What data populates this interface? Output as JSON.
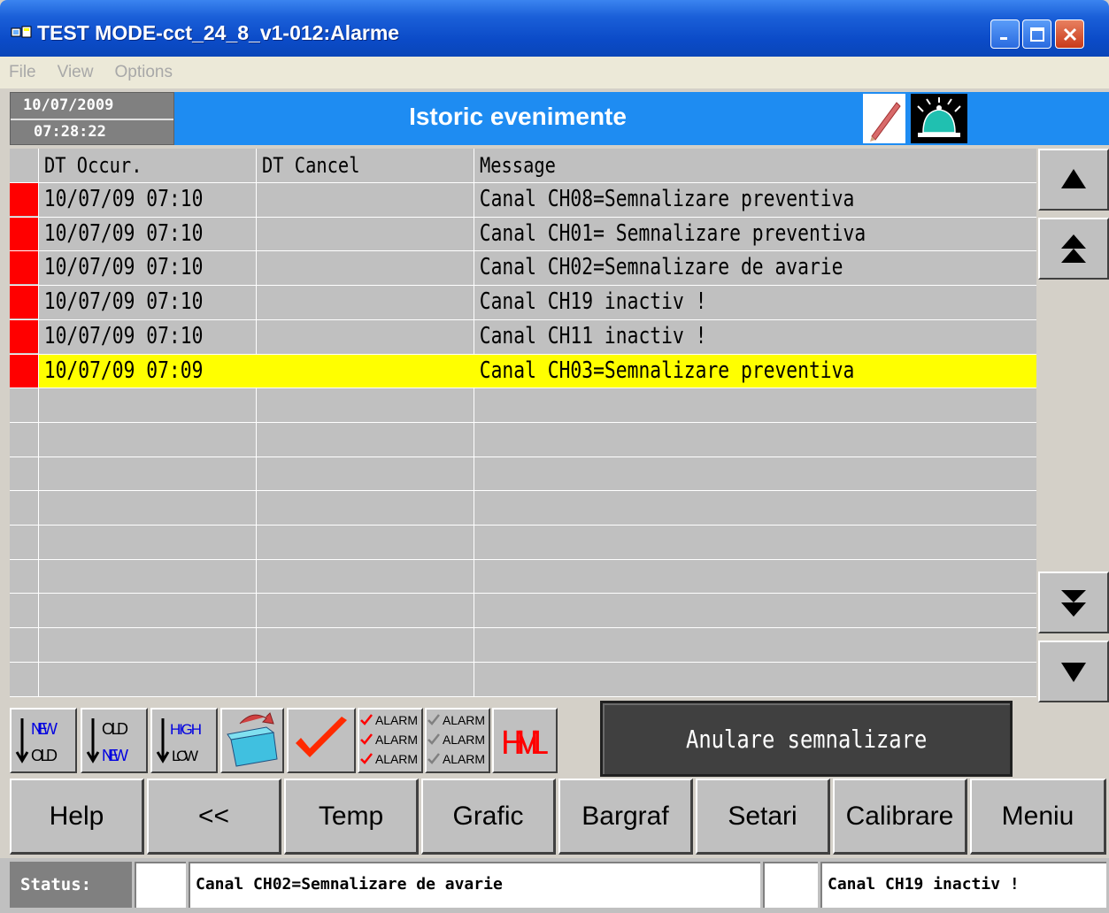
{
  "window": {
    "title": "TEST MODE-cct_24_8_v1-012:Alarme",
    "controls": {
      "minimize": "_",
      "maximize": "□",
      "close": "✕"
    }
  },
  "menu": [
    "File",
    "View",
    "Options"
  ],
  "header": {
    "date": "10/07/2009",
    "time": "07:28:22",
    "title": "Istoric evenimente",
    "icons": [
      "pencil-icon",
      "alarm-bell-icon"
    ]
  },
  "table": {
    "columns": [
      "DT Occur.",
      "DT Cancel",
      "Message"
    ],
    "rows": [
      {
        "occur": "10/07/09 07:10",
        "cancel": "",
        "message": "Canal CH08=Semnalizare preventiva",
        "highlight": false
      },
      {
        "occur": "10/07/09 07:10",
        "cancel": "",
        "message": "Canal CH01= Semnalizare preventiva",
        "highlight": false
      },
      {
        "occur": "10/07/09 07:10",
        "cancel": "",
        "message": "Canal CH02=Semnalizare de avarie",
        "highlight": false
      },
      {
        "occur": "10/07/09 07:10",
        "cancel": "",
        "message": "Canal CH19 inactiv !",
        "highlight": false
      },
      {
        "occur": "10/07/09 07:10",
        "cancel": "",
        "message": "Canal CH11 inactiv !",
        "highlight": false
      },
      {
        "occur": "10/07/09 07:09",
        "cancel": "",
        "message": "Canal CH03=Semnalizare preventiva",
        "highlight": true
      }
    ],
    "marker_color": "#ff0000",
    "highlight_color": "#ffff00"
  },
  "scroll_buttons": [
    "scroll-up-icon",
    "scroll-top-icon",
    "scroll-bottom-icon",
    "scroll-down-icon"
  ],
  "toolbar": {
    "sort_new_old": {
      "top": "NEW",
      "bottom": "OLD"
    },
    "sort_old_new": {
      "top": "OLD",
      "bottom": "NEW"
    },
    "sort_high_low": {
      "top": "HIGH",
      "bottom": "LOW"
    },
    "alarm_label": "ALARM",
    "hml_label": "HML",
    "cancel_signal": "Anulare semnalizare"
  },
  "nav": [
    "Help",
    "<<",
    "Temp",
    "Grafic",
    "Bargraf",
    "Setari",
    "Calibrare",
    "Meniu"
  ],
  "status": {
    "label": "Status:",
    "msg1": "Canal CH02=Semnalizare de avarie",
    "msg2": "Canal CH19 inactiv !"
  }
}
